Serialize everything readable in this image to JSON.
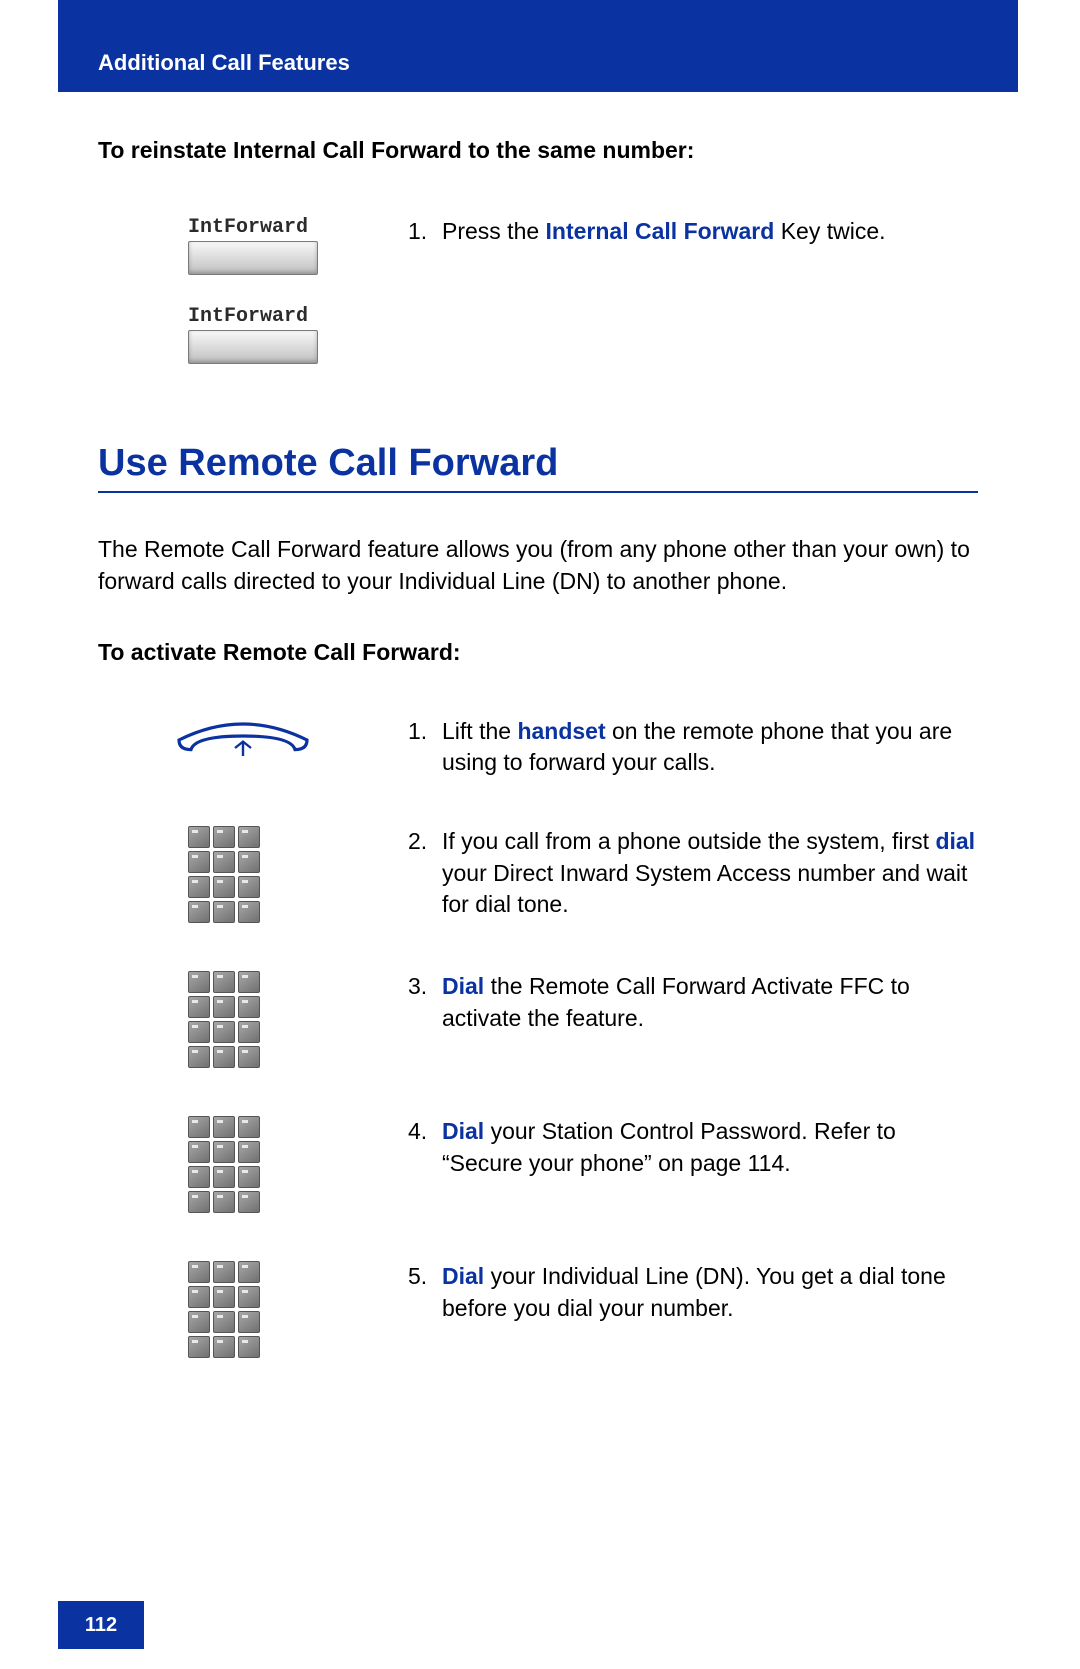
{
  "header": {
    "title": "Additional Call Features"
  },
  "section1": {
    "heading": "To reinstate Internal Call Forward to the same number:",
    "keyLabel": "IntForward",
    "step1": {
      "num": "1.",
      "pre": "Press the ",
      "boldBlue": "Internal Call Forward",
      "post": " Key twice."
    }
  },
  "section2": {
    "title": "Use Remote Call Forward",
    "intro": "The Remote Call Forward feature allows you (from any phone other than your own) to forward calls directed to your Individual Line (DN) to another phone.",
    "subheading": "To activate Remote Call Forward:",
    "steps": [
      {
        "num": "1.",
        "pre": "Lift the ",
        "boldBlue": "handset",
        "post": " on the remote phone that you are using to forward your calls.",
        "icon": "handset"
      },
      {
        "num": "2.",
        "pre": "If you call from a phone outside the system, first ",
        "boldBlue": "dial",
        "post": " your Direct Inward System Access number and wait for dial tone.",
        "icon": "dialpad"
      },
      {
        "num": "3.",
        "pre": "",
        "boldBlue": "Dial",
        "post": " the Remote Call Forward Activate FFC to activate the feature.",
        "icon": "dialpad"
      },
      {
        "num": "4.",
        "pre": "",
        "boldBlue": "Dial",
        "post": " your Station Control Password. Refer to “Secure your phone” on page 114.",
        "icon": "dialpad"
      },
      {
        "num": "5.",
        "pre": "",
        "boldBlue": "Dial",
        "post": " your Individual Line (DN). You get a dial tone before you dial your number.",
        "icon": "dialpad"
      }
    ]
  },
  "pageNumber": "112"
}
